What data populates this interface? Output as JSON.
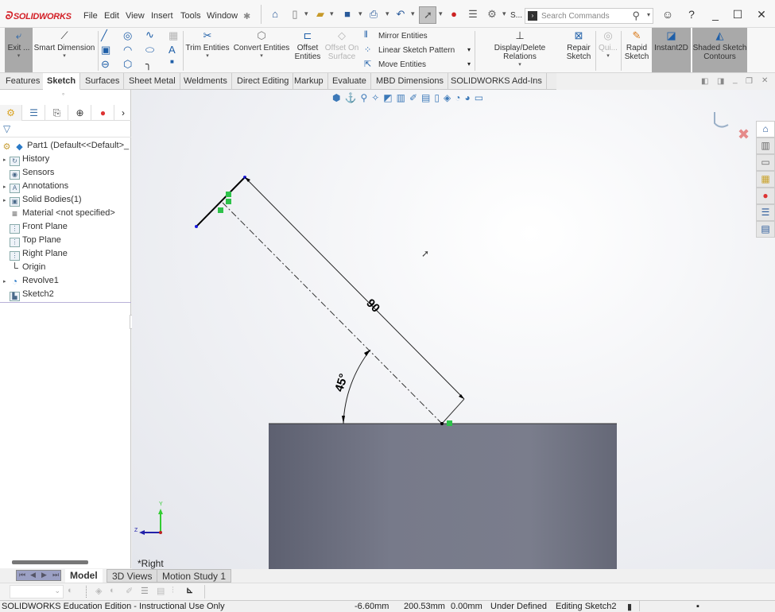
{
  "app": {
    "brand": "SOLIDWORKS"
  },
  "menu": [
    "File",
    "Edit",
    "View",
    "Insert",
    "Tools",
    "Window"
  ],
  "quick_access": {
    "icons": [
      "home-icon",
      "new-icon",
      "open-icon",
      "save-icon",
      "print-icon",
      "undo-icon",
      "select-icon",
      "rebuild-icon",
      "file-properties-icon",
      "options-icon"
    ],
    "truncated_label": "S..."
  },
  "search": {
    "placeholder": "Search Commands"
  },
  "commands": {
    "exit_sketch": "Exit ...",
    "smart_dimension": "Smart Dimension",
    "trim_entities": "Trim Entities",
    "convert_entities": "Convert Entities",
    "offset_entities_1": "Offset",
    "offset_entities_2": "Entities",
    "offset_on_surface_1": "Offset On",
    "offset_on_surface_2": "Surface",
    "mirror_entities": "Mirror Entities",
    "linear_sketch_pattern": "Linear Sketch Pattern",
    "move_entities": "Move Entities",
    "display_delete_relations": "Display/Delete Relations",
    "repair_sketch_1": "Repair",
    "repair_sketch_2": "Sketch",
    "quick_snaps": "Qui...",
    "rapid_sketch_1": "Rapid",
    "rapid_sketch_2": "Sketch",
    "instant2d": "Instant2D",
    "shaded_sketch_1": "Shaded Sketch",
    "shaded_sketch_2": "Contours"
  },
  "tabs": [
    {
      "label": "Features",
      "active": false
    },
    {
      "label": "Sketch",
      "active": true
    },
    {
      "label": "Surfaces",
      "active": false
    },
    {
      "label": "Sheet Metal",
      "active": false
    },
    {
      "label": "Weldments",
      "active": false
    },
    {
      "label": "Direct Editing",
      "active": false
    },
    {
      "label": "Markup",
      "active": false
    },
    {
      "label": "Evaluate",
      "active": false
    },
    {
      "label": "MBD Dimensions",
      "active": false
    },
    {
      "label": "SOLIDWORKS Add-Ins",
      "active": false
    }
  ],
  "feature_tree": {
    "root": "Part1  (Default<<Default>_",
    "items": [
      {
        "label": "History",
        "expandable": true,
        "icon": "history-folder-icon"
      },
      {
        "label": "Sensors",
        "expandable": false,
        "icon": "sensors-folder-icon"
      },
      {
        "label": "Annotations",
        "expandable": true,
        "icon": "annotations-folder-icon"
      },
      {
        "label": "Solid Bodies(1)",
        "expandable": true,
        "icon": "solid-bodies-folder-icon"
      },
      {
        "label": "Material <not specified>",
        "expandable": false,
        "icon": "material-icon"
      },
      {
        "label": "Front Plane",
        "expandable": false,
        "icon": "plane-icon"
      },
      {
        "label": "Top Plane",
        "expandable": false,
        "icon": "plane-icon"
      },
      {
        "label": "Right Plane",
        "expandable": false,
        "icon": "plane-icon"
      },
      {
        "label": "Origin",
        "expandable": false,
        "icon": "origin-icon"
      },
      {
        "label": "Revolve1",
        "expandable": true,
        "icon": "revolve-icon"
      },
      {
        "label": "Sketch2",
        "expandable": false,
        "icon": "sketch-icon"
      }
    ]
  },
  "viewport": {
    "view_name": "*Right",
    "dimension_length": "90",
    "dimension_angle": "45°",
    "axis_y": "Y",
    "axis_z": "Z"
  },
  "bottom_tabs": [
    {
      "label": "Model",
      "active": true
    },
    {
      "label": "3D Views",
      "active": false
    },
    {
      "label": "Motion Study 1",
      "active": false
    }
  ],
  "status": {
    "edition": "SOLIDWORKS Education Edition - Instructional Use Only",
    "x": "-6.60mm",
    "y": "200.53mm",
    "z": "0.00mm",
    "state": "Under Defined",
    "editing": "Editing Sketch2"
  },
  "colors": {
    "brand_red": "#d32027",
    "sketch_line": "#000000",
    "relation_green": "#2ec24a",
    "endpoint_blue": "#1a1ae0",
    "body_gray": "#727585",
    "pressed_button": "#a9a9a9"
  }
}
